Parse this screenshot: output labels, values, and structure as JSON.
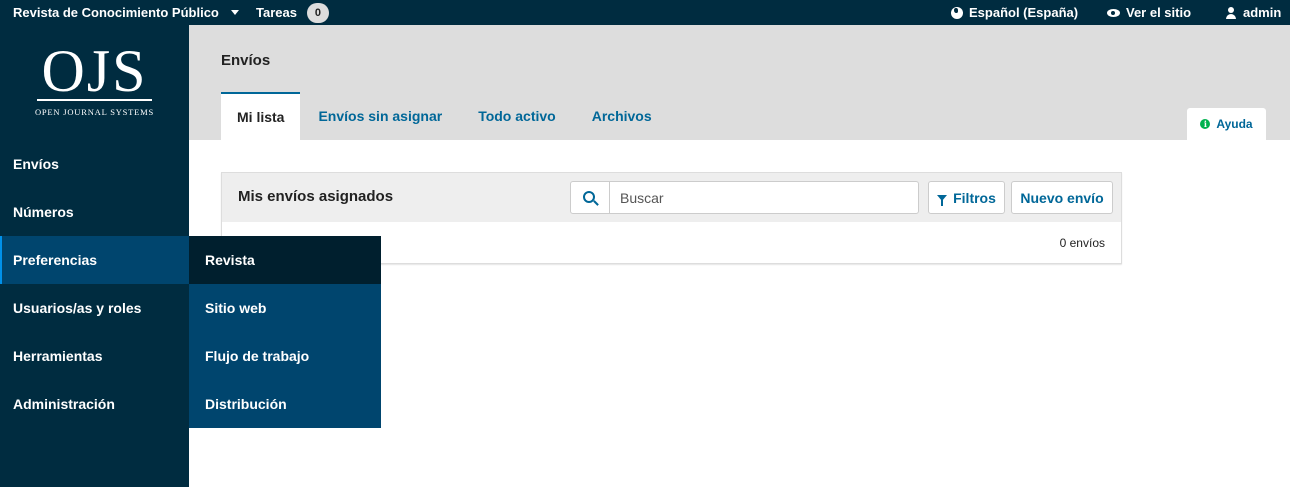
{
  "topbar": {
    "journal": "Revista de Conocimiento Público",
    "tasks_label": "Tareas",
    "tasks_count": "0",
    "language": "Español (España)",
    "view_site": "Ver el sitio",
    "user": "admin"
  },
  "logo": {
    "mark": "OJS",
    "subtitle": "OPEN JOURNAL SYSTEMS"
  },
  "sidebar": {
    "items": [
      {
        "label": "Envíos"
      },
      {
        "label": "Números"
      },
      {
        "label": "Preferencias"
      },
      {
        "label": "Usuarios/as y roles"
      },
      {
        "label": "Herramientas"
      },
      {
        "label": "Administración"
      }
    ]
  },
  "submenu": {
    "items": [
      {
        "label": "Revista"
      },
      {
        "label": "Sitio web"
      },
      {
        "label": "Flujo de trabajo"
      },
      {
        "label": "Distribución"
      }
    ]
  },
  "header": {
    "title": "Envíos",
    "tabs": [
      {
        "label": "Mi lista"
      },
      {
        "label": "Envíos sin asignar"
      },
      {
        "label": "Todo activo"
      },
      {
        "label": "Archivos"
      }
    ],
    "help": "Ayuda"
  },
  "panel": {
    "title": "Mis envíos asignados",
    "search_placeholder": "Buscar",
    "filters": "Filtros",
    "new_submission": "Nuevo envío",
    "count": "0 envíos"
  },
  "icons": {
    "topbar_language": "globe-icon",
    "topbar_view_site": "eye-icon",
    "topbar_user": "user-icon",
    "help": "info-icon",
    "search": "search-icon",
    "filters": "filter-icon"
  },
  "colors": {
    "nav_dark": "#002c40",
    "nav_active": "#00456e",
    "submenu_current": "#001f2e",
    "link": "#006798",
    "help_icon": "#00b24e",
    "header_bg": "#dddddd"
  }
}
